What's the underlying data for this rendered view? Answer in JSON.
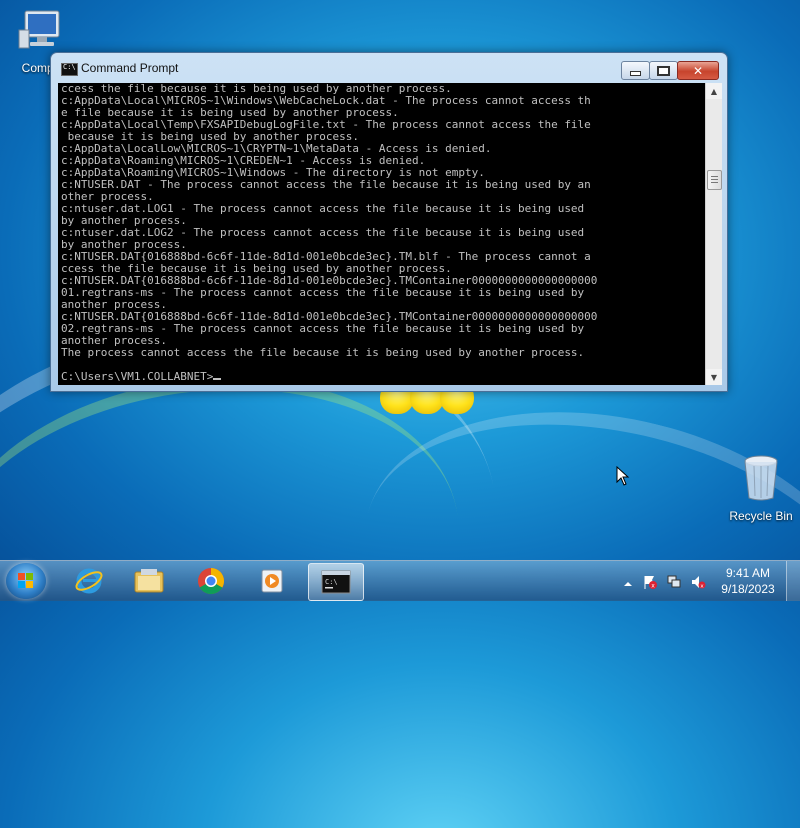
{
  "desktop": {
    "icons": [
      {
        "label": "Compu"
      },
      {
        "label": "Recycle Bin"
      }
    ]
  },
  "window": {
    "title": "Command Prompt",
    "console_lines": [
      "ccess the file because it is being used by another process.",
      "c:AppData\\Local\\MICROS~1\\Windows\\WebCacheLock.dat - The process cannot access th",
      "e file because it is being used by another process.",
      "c:AppData\\Local\\Temp\\FXSAPIDebugLogFile.txt - The process cannot access the file",
      " because it is being used by another process.",
      "c:AppData\\LocalLow\\MICROS~1\\CRYPTN~1\\MetaData - Access is denied.",
      "c:AppData\\Roaming\\MICROS~1\\CREDEN~1 - Access is denied.",
      "c:AppData\\Roaming\\MICROS~1\\Windows - The directory is not empty.",
      "c:NTUSER.DAT - The process cannot access the file because it is being used by an",
      "other process.",
      "c:ntuser.dat.LOG1 - The process cannot access the file because it is being used",
      "by another process.",
      "c:ntuser.dat.LOG2 - The process cannot access the file because it is being used",
      "by another process.",
      "c:NTUSER.DAT{016888bd-6c6f-11de-8d1d-001e0bcde3ec}.TM.blf - The process cannot a",
      "ccess the file because it is being used by another process.",
      "c:NTUSER.DAT{016888bd-6c6f-11de-8d1d-001e0bcde3ec}.TMContainer0000000000000000000",
      "01.regtrans-ms - The process cannot access the file because it is being used by",
      "another process.",
      "c:NTUSER.DAT{016888bd-6c6f-11de-8d1d-001e0bcde3ec}.TMContainer0000000000000000000",
      "02.regtrans-ms - The process cannot access the file because it is being used by",
      "another process.",
      "The process cannot access the file because it is being used by another process.",
      "",
      "C:\\Users\\VM1.COLLABNET>"
    ],
    "buttons": {
      "minimize": "minimize",
      "maximize": "maximize",
      "close": "close"
    }
  },
  "taskbar": {
    "items": [
      "start",
      "internet-explorer",
      "file-explorer",
      "chrome",
      "media-player",
      "command-prompt"
    ],
    "active": "command-prompt",
    "clock": {
      "time": "9:41 AM",
      "date": "9/18/2023"
    }
  },
  "colors": {
    "console_bg": "#000000",
    "console_fg": "#c0c0c0",
    "close_button": "#c7442d"
  }
}
